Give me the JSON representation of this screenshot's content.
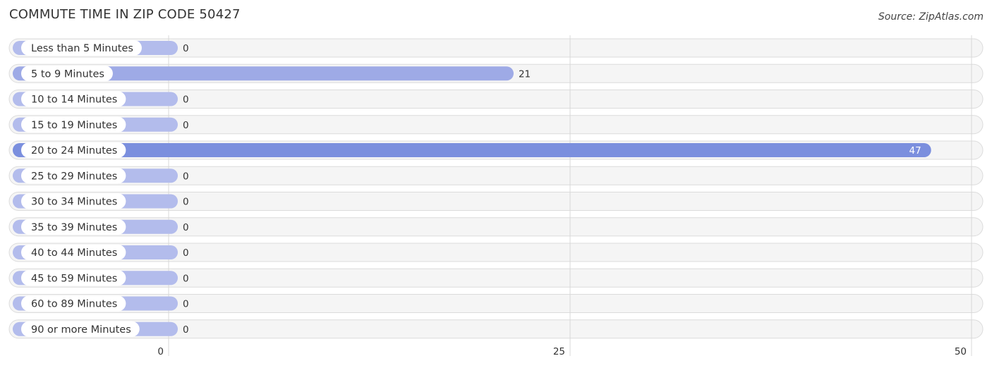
{
  "header": {
    "title": "COMMUTE TIME IN ZIP CODE 50427",
    "source": "Source: ZipAtlas.com"
  },
  "colors": {
    "bar_default": "#b3bcec",
    "bar_mid": "#9eaae6",
    "bar_max": "#7b8fde",
    "row_background": "#f5f5f5"
  },
  "chart_data": {
    "type": "bar",
    "orientation": "horizontal",
    "title": "COMMUTE TIME IN ZIP CODE 50427",
    "xlabel": "",
    "ylabel": "",
    "categories": [
      "Less than 5 Minutes",
      "5 to 9 Minutes",
      "10 to 14 Minutes",
      "15 to 19 Minutes",
      "20 to 24 Minutes",
      "25 to 29 Minutes",
      "30 to 34 Minutes",
      "35 to 39 Minutes",
      "40 to 44 Minutes",
      "45 to 59 Minutes",
      "60 to 89 Minutes",
      "90 or more Minutes"
    ],
    "values": [
      0,
      21,
      0,
      0,
      47,
      0,
      0,
      0,
      0,
      0,
      0,
      0
    ],
    "xlim": [
      0,
      50
    ],
    "ticks": [
      0,
      25,
      50
    ],
    "tick_labels": [
      "0",
      "25",
      "50"
    ],
    "grid": true,
    "legend": "none"
  }
}
